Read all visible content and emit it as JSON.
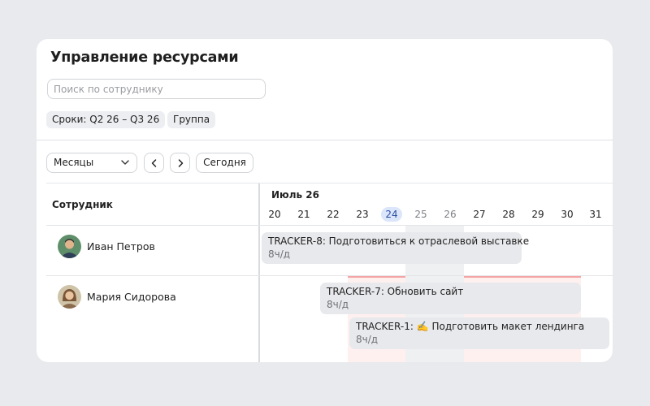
{
  "page": {
    "title": "Управление ресурсами",
    "search_placeholder": "Поиск по сотруднику"
  },
  "filters": {
    "period": "Сроки: Q2 26 – Q3 26",
    "group": "Группа"
  },
  "toolbar": {
    "scale_value": "Месяцы",
    "today_label": "Сегодня"
  },
  "table": {
    "employee_header": "Сотрудник",
    "month": "Июль 26",
    "days": [
      "20",
      "21",
      "22",
      "23",
      "24",
      "25",
      "26",
      "27",
      "28",
      "29",
      "30",
      "31"
    ],
    "today": "24",
    "weekend_days": [
      "25",
      "26"
    ]
  },
  "employees": [
    {
      "name": "Иван Петров",
      "tasks": [
        {
          "title": "TRACKER-8: Подготовиться к отраслевой выставке",
          "hours": "8ч/д"
        }
      ]
    },
    {
      "name": "Мария Сидорова",
      "tasks": [
        {
          "title": "TRACKER-7: Обновить сайт",
          "hours": "8ч/д"
        },
        {
          "title_prefix": "TRACKER-1:",
          "emoji": "✍️",
          "title_suffix": "Подготовить макет лендинга",
          "hours": "8ч/д"
        }
      ]
    }
  ],
  "colors": {
    "accent": "#2b4ea0",
    "today_bg": "#dce6fa",
    "overload": "#fff0f0",
    "overload_line": "#f4a4a4",
    "task_bg": "#e8e9ec"
  }
}
